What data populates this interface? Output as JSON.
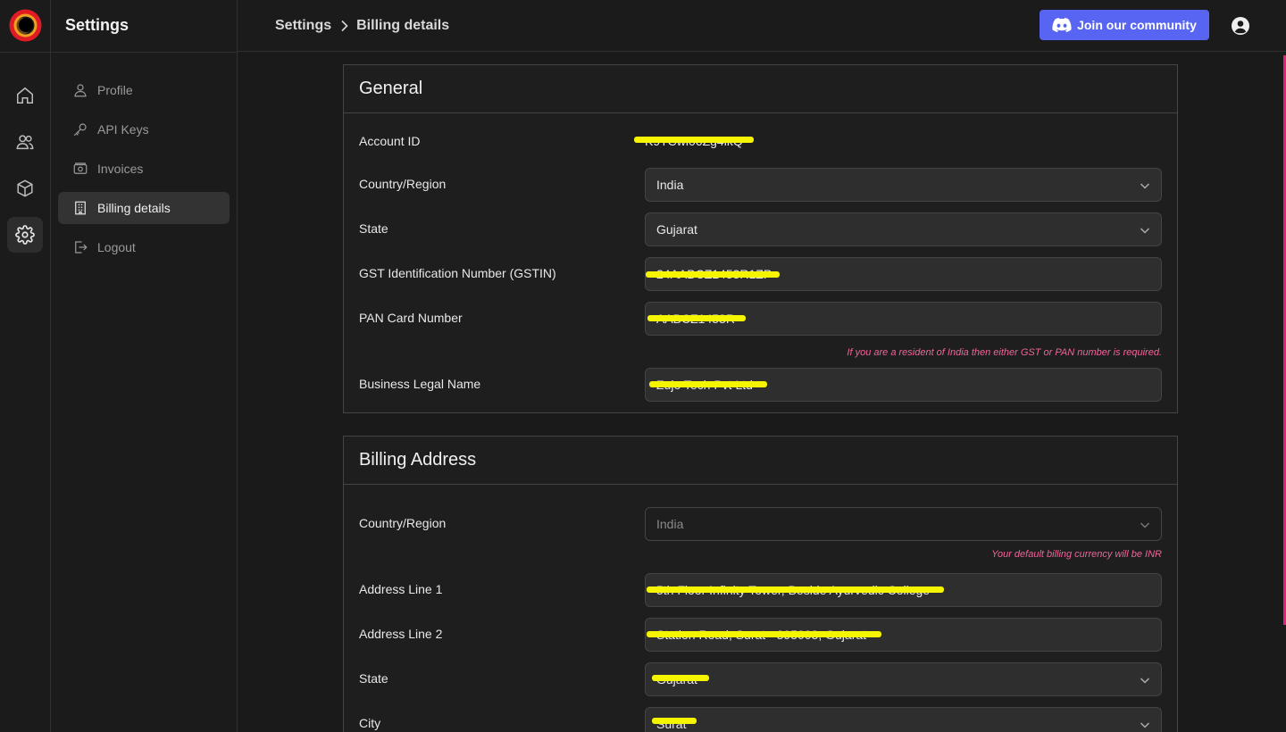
{
  "app": {
    "title": "Settings",
    "brand_color": "#e2237a",
    "rail": [
      {
        "icon": "home-icon"
      },
      {
        "icon": "users-icon"
      },
      {
        "icon": "cube-icon"
      },
      {
        "icon": "gear-icon",
        "active": true
      }
    ]
  },
  "sidebar": {
    "items": [
      {
        "label": "Profile",
        "icon": "user-icon"
      },
      {
        "label": "API Keys",
        "icon": "key-icon"
      },
      {
        "label": "Invoices",
        "icon": "invoice-icon"
      },
      {
        "label": "Billing details",
        "icon": "building-icon",
        "active": true
      },
      {
        "label": "Logout",
        "icon": "logout-icon"
      }
    ]
  },
  "header": {
    "breadcrumb": [
      "Settings",
      "Billing details"
    ],
    "join_label": "Join our community",
    "join_color": "#5865f2"
  },
  "general": {
    "heading": "General",
    "account_id_label": "Account ID",
    "account_id_value": "K9TCwl06Zg4lkQ",
    "country_label": "Country/Region",
    "country_value": "India",
    "state_label": "State",
    "state_value": "Gujarat",
    "gstin_label": "GST Identification Number (GSTIN)",
    "gstin_value": "24AABCZ1453R1ZP",
    "pan_label": "PAN Card Number",
    "pan_value": "AABCZ1453R",
    "gst_pan_note": "If you are a resident of India then either GST or PAN number is required.",
    "legal_name_label": "Business Legal Name",
    "legal_name_value": "Zujo Tech Pvt Ltd"
  },
  "billing": {
    "heading": "Billing Address",
    "country_label": "Country/Region",
    "country_value": "India",
    "currency_note": "Your default billing currency will be INR",
    "address1_label": "Address Line 1",
    "address1_value": "5th Floor Infinity Tower, Beside Ayurvedic College",
    "address2_label": "Address Line 2",
    "address2_value": "Station Road, Surat - 395003, Gujarat",
    "state_label": "State",
    "state_value": "Gujarat",
    "city_label": "City",
    "city_value": "Surat"
  }
}
